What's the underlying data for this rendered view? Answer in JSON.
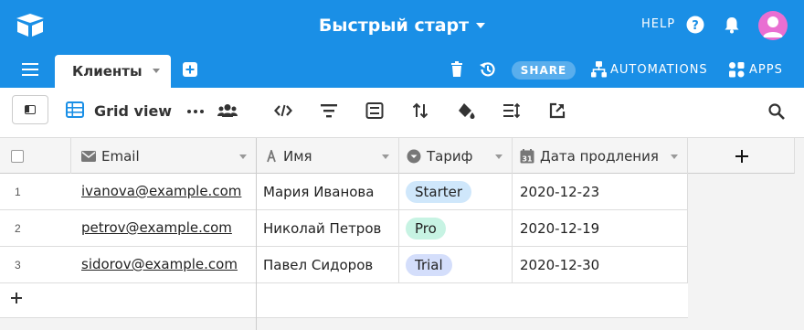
{
  "header": {
    "base_title": "Быстрый старт",
    "help_label": "HELP"
  },
  "tabs": [
    {
      "label": "Клиенты"
    }
  ],
  "actions": {
    "share_label": "SHARE",
    "automations_label": "AUTOMATIONS",
    "apps_label": "APPS"
  },
  "view": {
    "name": "Grid view"
  },
  "columns": [
    {
      "label": "Email",
      "icon": "email-icon"
    },
    {
      "label": "Имя",
      "icon": "text-field-icon"
    },
    {
      "label": "Тариф",
      "icon": "single-select-icon"
    },
    {
      "label": "Дата продления",
      "icon": "calendar-icon"
    }
  ],
  "rows": [
    {
      "num": "1",
      "email": "ivanova@example.com",
      "name": "Мария Иванова",
      "plan": "Starter",
      "plan_color": "#cfe7fb",
      "renewal": "2020-12-23"
    },
    {
      "num": "2",
      "email": "petrov@example.com",
      "name": "Николай Петров",
      "plan": "Pro",
      "plan_color": "#c7f3e3",
      "renewal": "2020-12-19"
    },
    {
      "num": "3",
      "email": "sidorov@example.com",
      "name": "Павел Сидоров",
      "plan": "Trial",
      "plan_color": "#d4defb",
      "renewal": "2020-12-30"
    }
  ],
  "colors": {
    "brand": "#1a8fe6",
    "avatar": "#e96fd2"
  }
}
